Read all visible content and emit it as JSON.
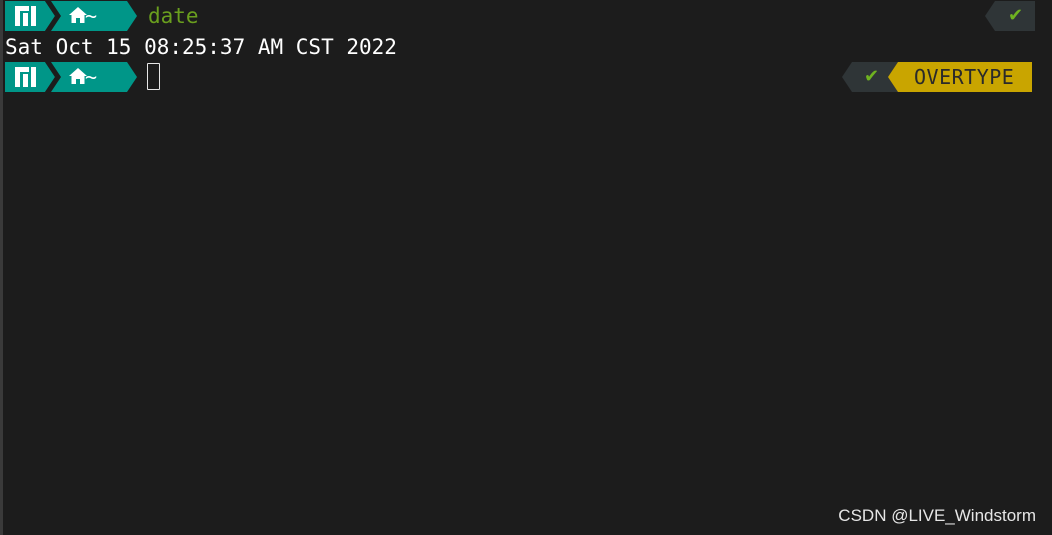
{
  "terminal": {
    "prompt_path": "~",
    "command": "date",
    "output": "Sat Oct 15 08:25:37 AM CST 2022",
    "mode_label": "OVERTYPE"
  },
  "icons": {
    "distro_logo": "manjaro-logo-icon",
    "home": "home-icon",
    "status_ok": "check-icon"
  },
  "status": {
    "ok_symbol": "✔"
  },
  "colors": {
    "background": "#1c1c1c",
    "prompt_teal": "#009688",
    "command_green": "#6a9f1e",
    "status_gray": "#2f3537",
    "check_green": "#6fb320",
    "overtype_yellow": "#c9a500"
  },
  "watermark": "CSDN @LIVE_Windstorm"
}
